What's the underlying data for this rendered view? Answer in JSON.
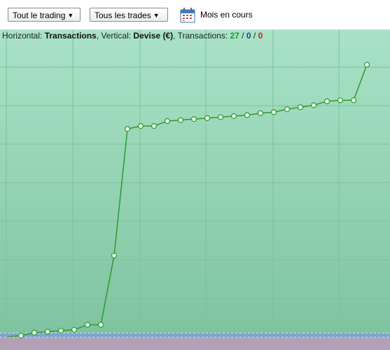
{
  "toolbar": {
    "trading_filter": "Tout le trading",
    "trades_filter": "Tous les trades",
    "period_label": "Mois en cours"
  },
  "info": {
    "horizontal_prefix": "Horizontal: ",
    "horizontal_value": "Transactions",
    "vertical_prefix": ", Vertical: ",
    "vertical_value": "Devise (€)",
    "transactions_prefix": ", Transactions: ",
    "winning": "27",
    "sep1": " / ",
    "neutral": "0",
    "sep2": " / ",
    "losing": "0"
  },
  "colors": {
    "line": "#2e9a2e",
    "point_fill": "#e8f7e8",
    "background_top": "#a9e2c7",
    "background_bottom": "#7cc29e",
    "baseline_band": "#7f9fdc",
    "negative_band": "#b4a0b4",
    "grid": "#7fbf9d"
  },
  "chart_data": {
    "type": "line",
    "title": "",
    "xlabel": "Transactions",
    "ylabel": "Devise (€)",
    "grid": true,
    "legend": "none",
    "x": [
      0,
      1,
      2,
      3,
      4,
      5,
      6,
      7,
      8,
      9,
      10,
      11,
      12,
      13,
      14,
      15,
      16,
      17,
      18,
      19,
      20,
      21,
      22,
      23,
      24,
      25,
      26,
      27
    ],
    "series": [
      {
        "values": [
          0,
          1,
          4,
          5,
          6,
          7,
          12,
          12,
          82,
          210,
          213,
          213,
          218,
          219,
          220,
          221,
          222,
          223,
          224,
          226,
          227,
          230,
          232,
          234,
          238,
          239,
          239,
          275
        ]
      }
    ],
    "ylim": [
      -5,
      310
    ]
  }
}
